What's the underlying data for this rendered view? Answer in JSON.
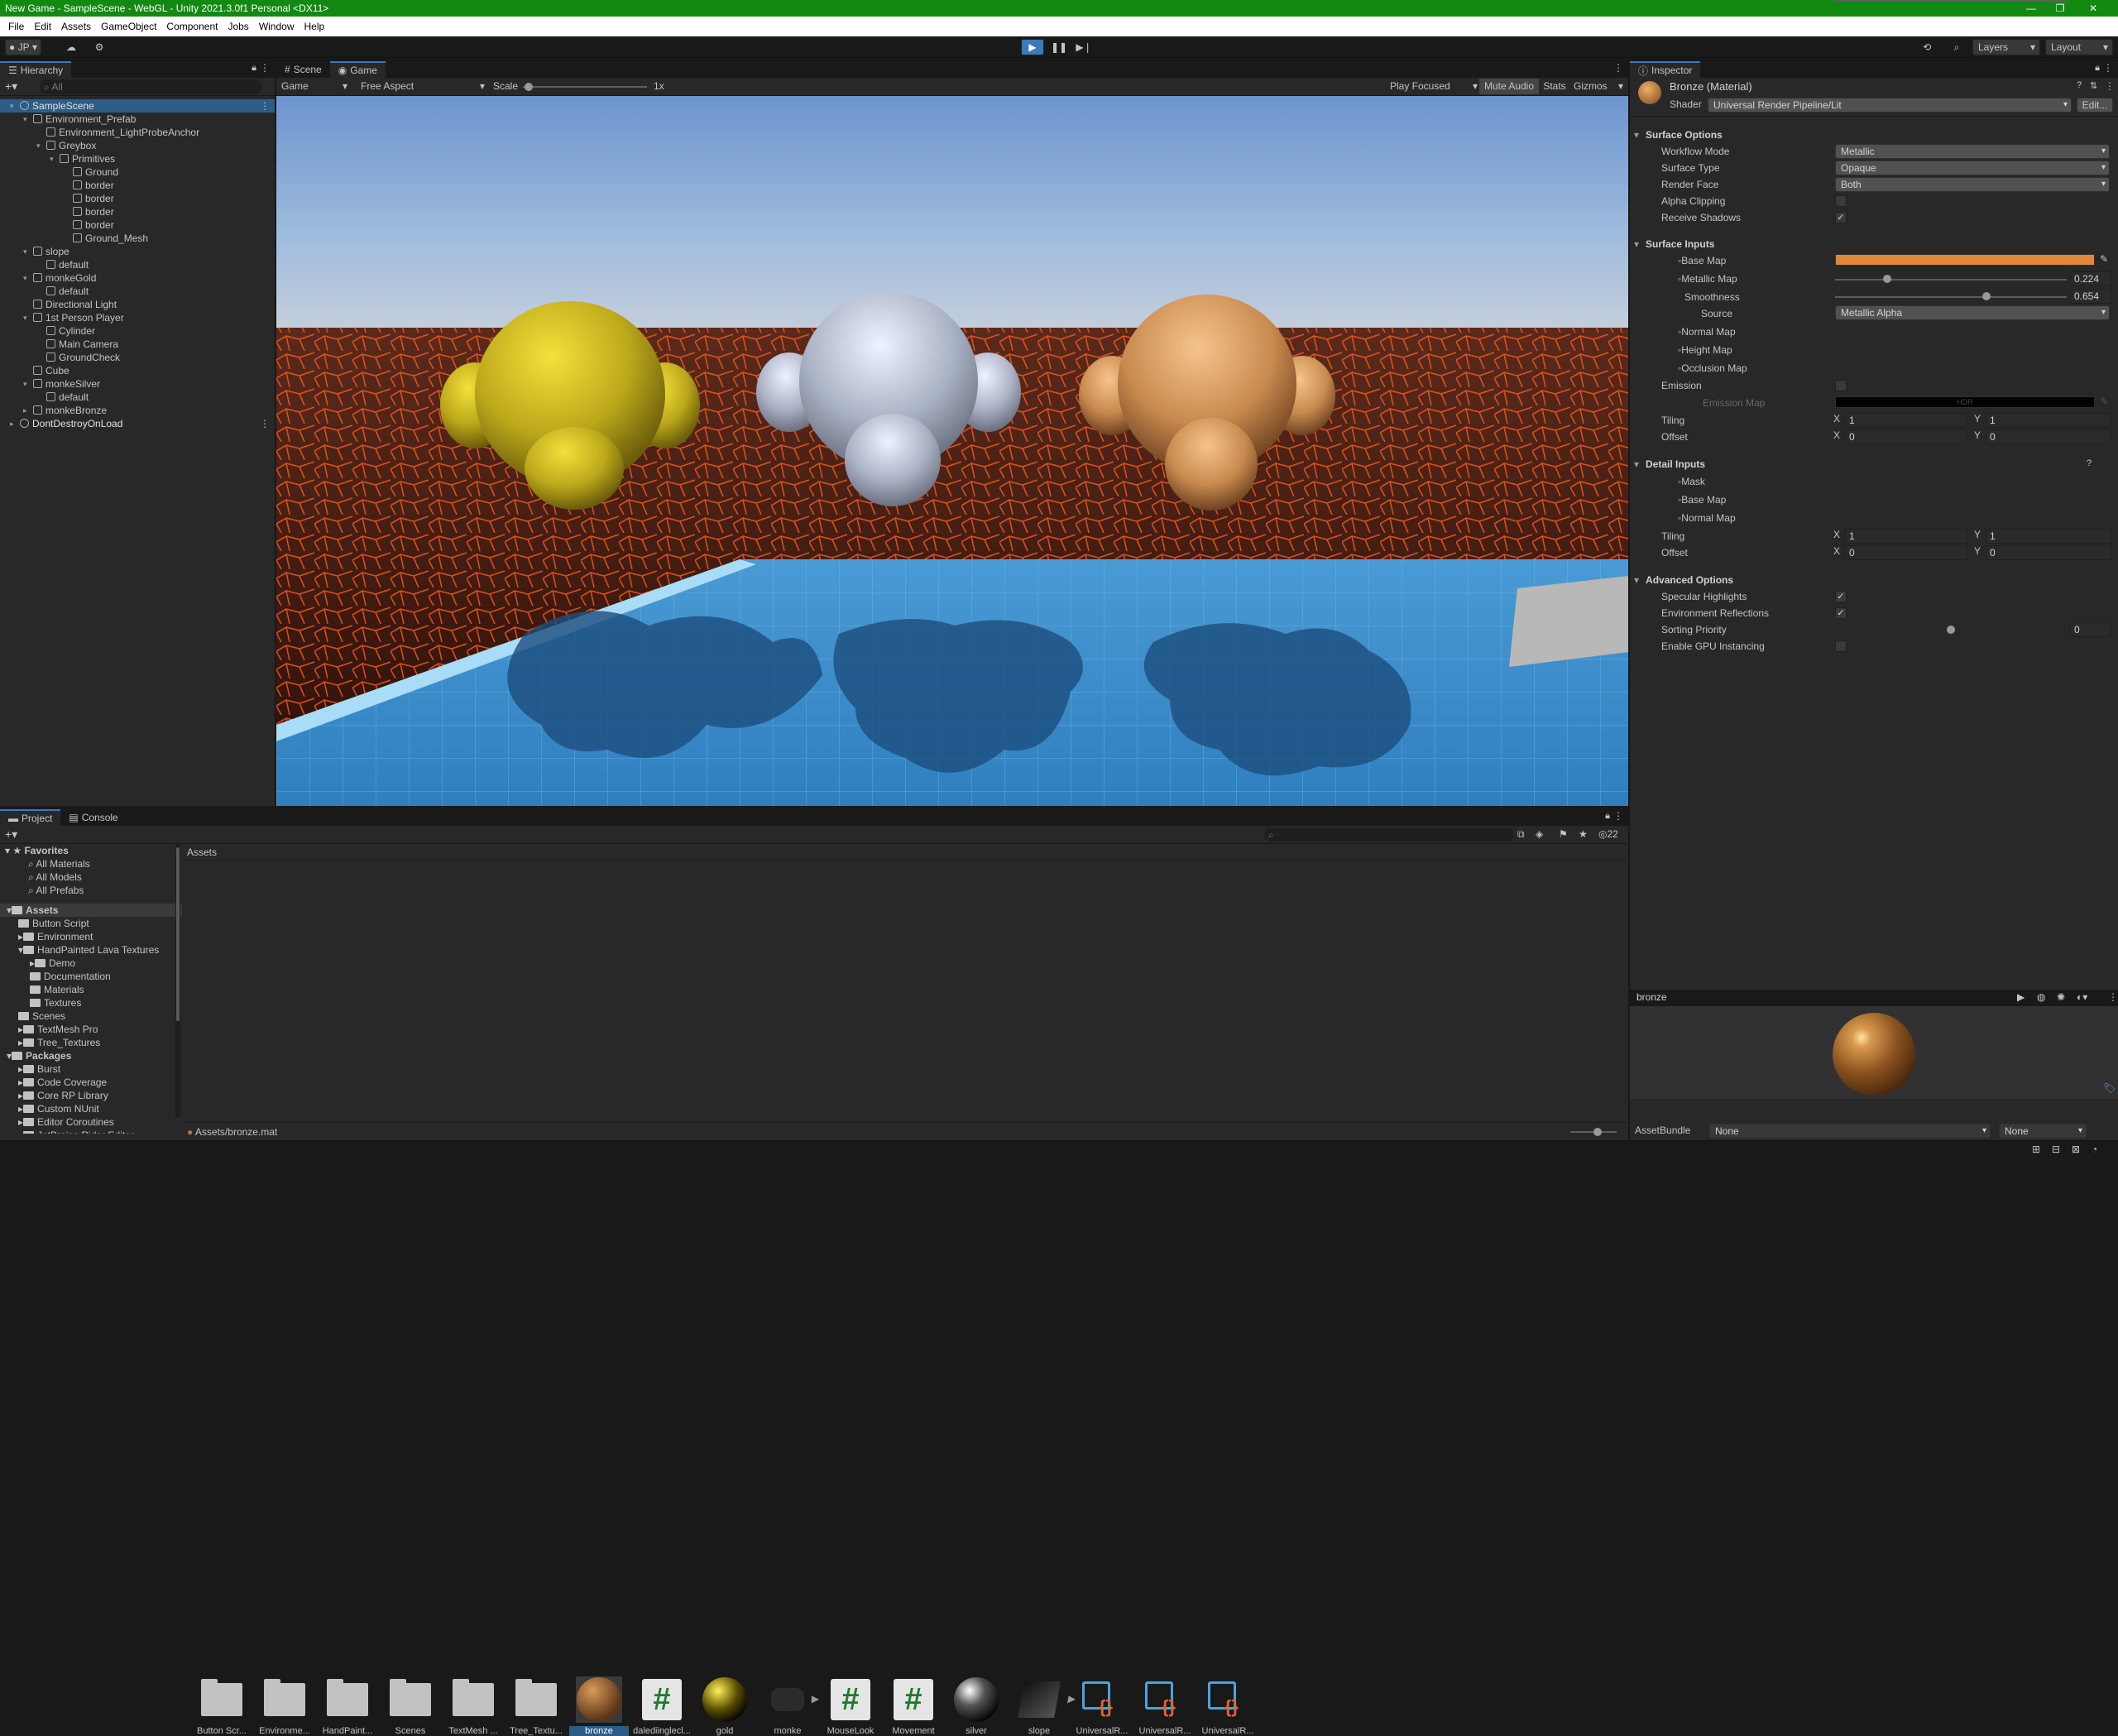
{
  "window": {
    "title": "New Game - SampleScene - WebGL - Unity 2021.3.0f1 Personal <DX11>"
  },
  "menu": [
    "File",
    "Edit",
    "Assets",
    "GameObject",
    "Component",
    "Jobs",
    "Window",
    "Help"
  ],
  "toolbar": {
    "account": "JP",
    "layers": "Layers",
    "layout": "Layout"
  },
  "hierarchy": {
    "tab": "Hierarchy",
    "search_placeholder": "All",
    "items": [
      {
        "label": "SampleScene",
        "depth": 0,
        "arrow": "▾",
        "scene": true
      },
      {
        "label": "Environment_Prefab",
        "depth": 1,
        "arrow": "▾"
      },
      {
        "label": "Environment_LightProbeAnchor",
        "depth": 2,
        "arrow": ""
      },
      {
        "label": "Greybox",
        "depth": 2,
        "arrow": "▾"
      },
      {
        "label": "Primitives",
        "depth": 3,
        "arrow": "▾"
      },
      {
        "label": "Ground",
        "depth": 4,
        "arrow": ""
      },
      {
        "label": "border",
        "depth": 4,
        "arrow": ""
      },
      {
        "label": "border",
        "depth": 4,
        "arrow": ""
      },
      {
        "label": "border",
        "depth": 4,
        "arrow": ""
      },
      {
        "label": "border",
        "depth": 4,
        "arrow": ""
      },
      {
        "label": "Ground_Mesh",
        "depth": 4,
        "arrow": ""
      },
      {
        "label": "slope",
        "depth": 1,
        "arrow": "▾"
      },
      {
        "label": "default",
        "depth": 2,
        "arrow": ""
      },
      {
        "label": "monkeGold",
        "depth": 1,
        "arrow": "▾"
      },
      {
        "label": "default",
        "depth": 2,
        "arrow": ""
      },
      {
        "label": "Directional Light",
        "depth": 1,
        "arrow": ""
      },
      {
        "label": "1st Person Player",
        "depth": 1,
        "arrow": "▾"
      },
      {
        "label": "Cylinder",
        "depth": 2,
        "arrow": ""
      },
      {
        "label": "Main Camera",
        "depth": 2,
        "arrow": ""
      },
      {
        "label": "GroundCheck",
        "depth": 2,
        "arrow": ""
      },
      {
        "label": "Cube",
        "depth": 1,
        "arrow": ""
      },
      {
        "label": "monkeSilver",
        "depth": 1,
        "arrow": "▾"
      },
      {
        "label": "default",
        "depth": 2,
        "arrow": ""
      },
      {
        "label": "monkeBronze",
        "depth": 1,
        "arrow": "▸"
      },
      {
        "label": "DontDestroyOnLoad",
        "depth": 0,
        "arrow": "▸",
        "scene": true
      }
    ]
  },
  "viewport": {
    "tabs": [
      "Scene",
      "Game"
    ],
    "display": "Game",
    "aspect": "Free Aspect",
    "scale_label": "Scale",
    "scale_value": "1x",
    "play_focused": "Play Focused",
    "mute_audio": "Mute Audio",
    "stats": "Stats",
    "gizmos": "Gizmos"
  },
  "inspector": {
    "tab": "Inspector",
    "material_name": "Bronze (Material)",
    "shader_label": "Shader",
    "shader_value": "Universal Render Pipeline/Lit",
    "edit_label": "Edit...",
    "surface_options": {
      "header": "Surface Options",
      "workflow_mode": {
        "label": "Workflow Mode",
        "value": "Metallic"
      },
      "surface_type": {
        "label": "Surface Type",
        "value": "Opaque"
      },
      "render_face": {
        "label": "Render Face",
        "value": "Both"
      },
      "alpha_clipping": {
        "label": "Alpha Clipping",
        "checked": false
      },
      "receive_shadows": {
        "label": "Receive Shadows",
        "checked": true
      }
    },
    "surface_inputs": {
      "header": "Surface Inputs",
      "base_map": "Base Map",
      "base_color": "#e0873c",
      "metallic_map": "Metallic Map",
      "metallic_value": "0.224",
      "metallic_fraction": 0.224,
      "smoothness": "Smoothness",
      "smoothness_value": "0.654",
      "smoothness_fraction": 0.654,
      "source_label": "Source",
      "source_value": "Metallic Alpha",
      "normal_map": "Normal Map",
      "height_map": "Height Map",
      "occlusion_map": "Occlusion Map",
      "emission": "Emission",
      "emission_map": "Emission Map",
      "hdr": "HDR",
      "tiling": "Tiling",
      "offset": "Offset",
      "tiling_x": "1",
      "tiling_y": "1",
      "offset_x": "0",
      "offset_y": "0"
    },
    "detail_inputs": {
      "header": "Detail Inputs",
      "mask": "Mask",
      "base_map": "Base Map",
      "normal_map": "Normal Map",
      "tiling": "Tiling",
      "offset": "Offset",
      "tiling_x": "1",
      "tiling_y": "1",
      "offset_x": "0",
      "offset_y": "0"
    },
    "advanced_options": {
      "header": "Advanced Options",
      "specular_highlights": {
        "label": "Specular Highlights",
        "checked": true
      },
      "environment_reflections": {
        "label": "Environment Reflections",
        "checked": true
      },
      "sorting_priority": {
        "label": "Sorting Priority",
        "value": "0"
      },
      "gpu_instancing": {
        "label": "Enable GPU Instancing",
        "checked": false
      }
    },
    "preview": {
      "name": "bronze"
    },
    "asset_bundle": {
      "label": "AssetBundle",
      "value": "None",
      "variant": "None"
    },
    "axis_x": "X",
    "axis_y": "Y"
  },
  "project": {
    "tabs": [
      "Project",
      "Console"
    ],
    "hidden_count": "22",
    "breadcrumb": "Assets",
    "favorites_header": "Favorites",
    "favorites": [
      "All Materials",
      "All Models",
      "All Prefabs"
    ],
    "tree": [
      {
        "label": "Assets",
        "depth": 0,
        "arrow": "▾",
        "bold": true
      },
      {
        "label": "Button Script",
        "depth": 1,
        "arrow": ""
      },
      {
        "label": "Environment",
        "depth": 1,
        "arrow": "▸"
      },
      {
        "label": "HandPainted Lava Textures",
        "depth": 1,
        "arrow": "▾"
      },
      {
        "label": "Demo",
        "depth": 2,
        "arrow": "▸"
      },
      {
        "label": "Documentation",
        "depth": 2,
        "arrow": ""
      },
      {
        "label": "Materials",
        "depth": 2,
        "arrow": ""
      },
      {
        "label": "Textures",
        "depth": 2,
        "arrow": ""
      },
      {
        "label": "Scenes",
        "depth": 1,
        "arrow": ""
      },
      {
        "label": "TextMesh Pro",
        "depth": 1,
        "arrow": "▸"
      },
      {
        "label": "Tree_Textures",
        "depth": 1,
        "arrow": "▸"
      },
      {
        "label": "Packages",
        "depth": 0,
        "arrow": "▾",
        "bold": true
      },
      {
        "label": "Burst",
        "depth": 1,
        "arrow": "▸"
      },
      {
        "label": "Code Coverage",
        "depth": 1,
        "arrow": "▸"
      },
      {
        "label": "Core RP Library",
        "depth": 1,
        "arrow": "▸"
      },
      {
        "label": "Custom NUnit",
        "depth": 1,
        "arrow": "▸"
      },
      {
        "label": "Editor Coroutines",
        "depth": 1,
        "arrow": "▸"
      },
      {
        "label": "JetBrains Rider Editor",
        "depth": 1,
        "arrow": "▸"
      }
    ],
    "assets": [
      {
        "label": "Button Scr...",
        "kind": "folder"
      },
      {
        "label": "Environme...",
        "kind": "folder"
      },
      {
        "label": "HandPaint...",
        "kind": "folder"
      },
      {
        "label": "Scenes",
        "kind": "folder"
      },
      {
        "label": "TextMesh ...",
        "kind": "folder"
      },
      {
        "label": "Tree_Textu...",
        "kind": "folder"
      },
      {
        "label": "bronze",
        "kind": "bronze",
        "selected": true
      },
      {
        "label": "dalediinglecl...",
        "kind": "script"
      },
      {
        "label": "gold",
        "kind": "gold"
      },
      {
        "label": "monke",
        "kind": "model"
      },
      {
        "label": "MouseLook",
        "kind": "script"
      },
      {
        "label": "Movement",
        "kind": "script"
      },
      {
        "label": "silver",
        "kind": "silver"
      },
      {
        "label": "slope",
        "kind": "slope"
      },
      {
        "label": "UniversalR...",
        "kind": "urp"
      },
      {
        "label": "UniversalR...",
        "kind": "urp"
      },
      {
        "label": "UniversalR...",
        "kind": "urp"
      }
    ],
    "footer_path": "Assets/bronze.mat"
  }
}
